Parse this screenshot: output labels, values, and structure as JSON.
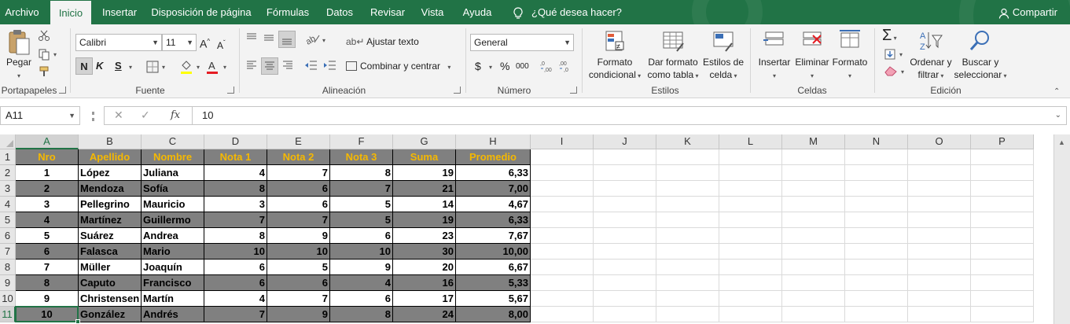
{
  "menu": {
    "tabs": [
      "Archivo",
      "Inicio",
      "Insertar",
      "Disposición de página",
      "Fórmulas",
      "Datos",
      "Revisar",
      "Vista",
      "Ayuda"
    ],
    "active_tab": "Inicio",
    "tell_me": "¿Qué desea hacer?",
    "share": "Compartir"
  },
  "ribbon": {
    "clipboard": {
      "paste_label": "Pegar",
      "group_label": "Portapapeles"
    },
    "font": {
      "font_name": "Calibri",
      "font_size": "11",
      "bold": "N",
      "italic": "K",
      "underline": "S",
      "group_label": "Fuente"
    },
    "alignment": {
      "wrap_text": "Ajustar texto",
      "merge_center": "Combinar y centrar",
      "group_label": "Alineación"
    },
    "number": {
      "format": "General",
      "currency": "$",
      "percent": "%",
      "thousands": "000",
      "group_label": "Número"
    },
    "styles": {
      "conditional_format_1": "Formato",
      "conditional_format_2": "condicional",
      "table_format_1": "Dar formato",
      "table_format_2": "como tabla",
      "cell_styles_1": "Estilos de",
      "cell_styles_2": "celda",
      "group_label": "Estilos"
    },
    "cells": {
      "insert": "Insertar",
      "delete": "Eliminar",
      "format": "Formato",
      "group_label": "Celdas"
    },
    "editing": {
      "sort_1": "Ordenar y",
      "sort_2": "filtrar",
      "find_1": "Buscar y",
      "find_2": "seleccionar",
      "group_label": "Edición"
    }
  },
  "formula_bar": {
    "name_box": "A11",
    "fx": "fx",
    "value": "10"
  },
  "grid": {
    "columns": [
      "A",
      "B",
      "C",
      "D",
      "E",
      "F",
      "G",
      "H",
      "I",
      "J",
      "K",
      "L",
      "M",
      "N",
      "O",
      "P"
    ],
    "rows": [
      "1",
      "2",
      "3",
      "4",
      "5",
      "6",
      "7",
      "8",
      "9",
      "10",
      "11"
    ],
    "selected_column": "A",
    "selected_row": "11",
    "header": [
      "Nro",
      "Apellido",
      "Nombre",
      "Nota 1",
      "Nota 2",
      "Nota 3",
      "Suma",
      "Promedio"
    ],
    "data": [
      [
        "1",
        "López",
        "Juliana",
        "4",
        "7",
        "8",
        "19",
        "6,33"
      ],
      [
        "2",
        "Mendoza",
        "Sofía",
        "8",
        "6",
        "7",
        "21",
        "7,00"
      ],
      [
        "3",
        "Pellegrino",
        "Mauricio",
        "3",
        "6",
        "5",
        "14",
        "4,67"
      ],
      [
        "4",
        "Martínez",
        "Guillermo",
        "7",
        "7",
        "5",
        "19",
        "6,33"
      ],
      [
        "5",
        "Suárez",
        "Andrea",
        "8",
        "9",
        "6",
        "23",
        "7,67"
      ],
      [
        "6",
        "Falasca",
        "Mario",
        "10",
        "10",
        "10",
        "30",
        "10,00"
      ],
      [
        "7",
        "Müller",
        "Joaquín",
        "6",
        "5",
        "9",
        "20",
        "6,67"
      ],
      [
        "8",
        "Caputo",
        "Francisco",
        "6",
        "6",
        "4",
        "16",
        "5,33"
      ],
      [
        "9",
        "Christensen",
        "Martín",
        "4",
        "7",
        "6",
        "17",
        "5,67"
      ],
      [
        "10",
        "González",
        "Andrés",
        "7",
        "9",
        "8",
        "24",
        "8,00"
      ]
    ]
  },
  "colors": {
    "excel_green": "#217346",
    "header_text": "#f5b800",
    "dark_row": "#808080"
  }
}
